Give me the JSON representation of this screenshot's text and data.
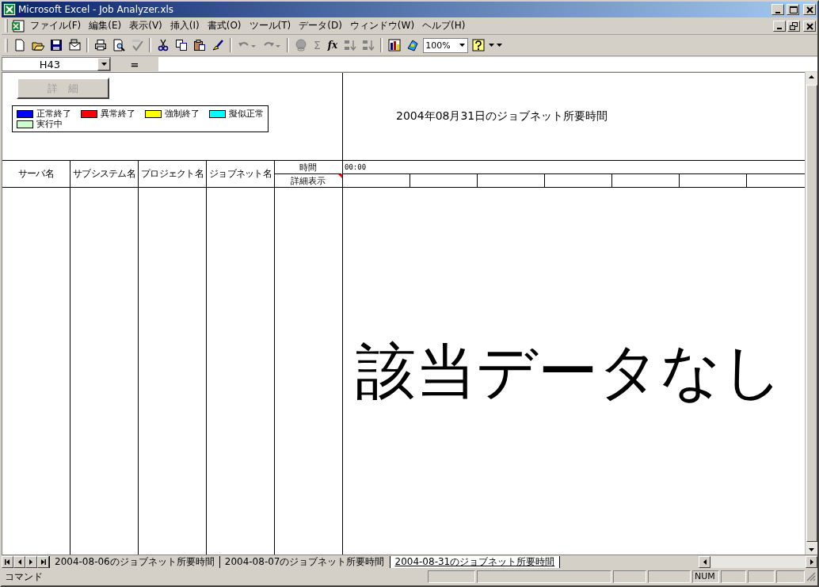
{
  "window": {
    "title": "Microsoft Excel - Job Analyzer.xls"
  },
  "menu": [
    "ファイル(F)",
    "編集(E)",
    "表示(V)",
    "挿入(I)",
    "書式(O)",
    "ツール(T)",
    "データ(D)",
    "ウィンドウ(W)",
    "ヘルプ(H)"
  ],
  "toolbar": {
    "sum": "Σ",
    "function": "fx",
    "zoom": "100%"
  },
  "formula_bar": {
    "name_box": "H43",
    "equals": "="
  },
  "sheet": {
    "detail_button": {
      "label": "詳　細",
      "disabled": true
    },
    "legend": [
      {
        "label": "正常終了",
        "color": "#0000ff"
      },
      {
        "label": "異常終了",
        "color": "#ff0000"
      },
      {
        "label": "強制終了",
        "color": "#ffff00"
      },
      {
        "label": "擬似正常",
        "color": "#00ffff"
      },
      {
        "label": "実行中",
        "color": "#ccffcc"
      }
    ],
    "chart_title": "2004年08月31日のジョブネット所要時間",
    "columns": [
      "サーバ名",
      "サブシステム名",
      "プロジェクト名",
      "ジョブネット名"
    ],
    "time_header": "時間",
    "detail_header": "詳細表示",
    "start_time": "00:00",
    "message": "該当データなし"
  },
  "sheet_tabs": [
    {
      "label": "2004-08-06のジョブネット所要時間",
      "selected": false
    },
    {
      "label": "2004-08-07のジョブネット所要時間",
      "selected": false
    },
    {
      "label": "2004-08-31のジョブネット所要時間",
      "selected": true
    }
  ],
  "status_bar": {
    "mode": "コマンド",
    "num": "NUM"
  }
}
